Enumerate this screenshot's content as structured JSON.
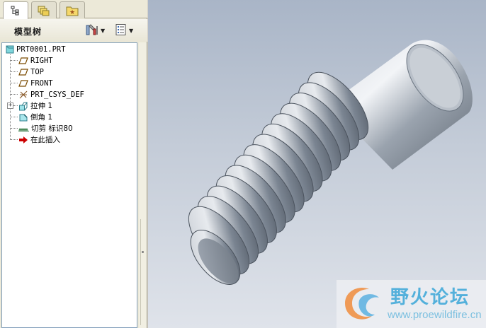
{
  "tabs": [
    {
      "icon": "model-tree-icon",
      "active": true
    },
    {
      "icon": "layers-icon",
      "active": false
    },
    {
      "icon": "favorites-folder-icon",
      "active": false
    }
  ],
  "panel": {
    "title": "模型树",
    "settings_button": "tree-settings-icon",
    "show_button": "show-options-icon"
  },
  "tree": {
    "root": "PRT0001.PRT",
    "items": [
      {
        "label": "RIGHT",
        "icon": "datum-plane-icon",
        "mono": true
      },
      {
        "label": "TOP",
        "icon": "datum-plane-icon",
        "mono": true
      },
      {
        "label": "FRONT",
        "icon": "datum-plane-icon",
        "mono": true
      },
      {
        "label": "PRT_CSYS_DEF",
        "icon": "coordinate-system-icon",
        "mono": true
      },
      {
        "label": "拉伸 1",
        "icon": "extrude-icon",
        "expandable": true
      },
      {
        "label": "倒角 1",
        "icon": "chamfer-icon"
      },
      {
        "label": "切剪 标识80",
        "icon": "cosmetic-thread-icon"
      },
      {
        "label": "在此插入",
        "icon": "insert-here-arrow-icon"
      }
    ]
  },
  "watermark": {
    "title": "野火论坛",
    "url": "www.proewildfire.cn"
  },
  "colors": {
    "viewport_top": "#a9b5c7",
    "viewport_bottom": "#dfe3ea",
    "tree_border": "#7f9db9",
    "watermark_text": "#53b0db",
    "insert_arrow": "#cc0000"
  }
}
